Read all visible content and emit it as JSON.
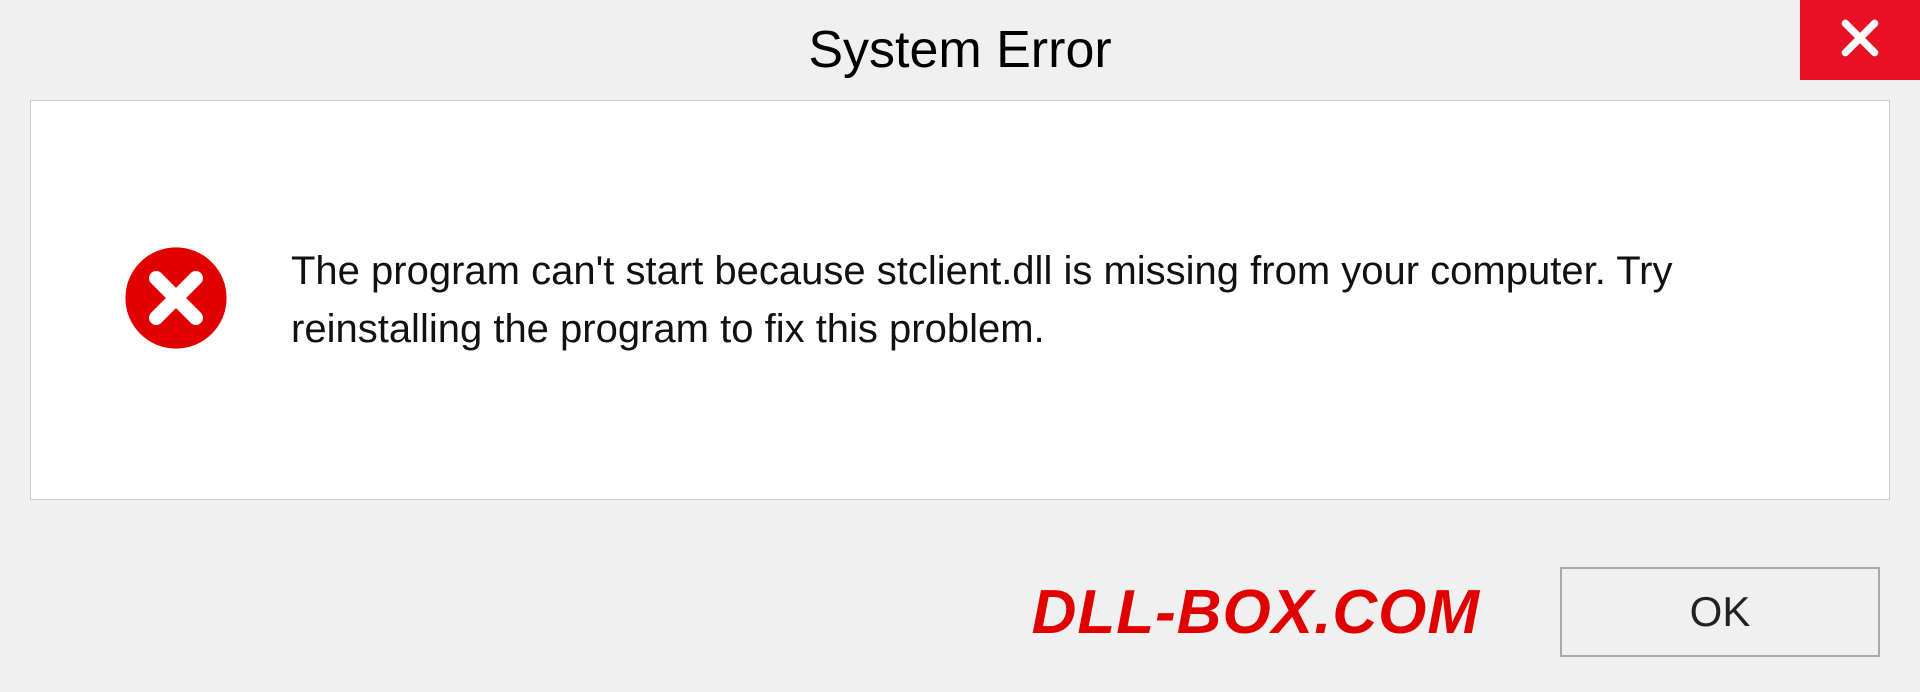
{
  "title": "System Error",
  "message": "The program can't start because stclient.dll is missing from your computer. Try reinstalling the program to fix this problem.",
  "brand": "DLL-BOX.COM",
  "ok_label": "OK",
  "colors": {
    "close_bg": "#e81123",
    "error_red": "#e00000",
    "brand_red": "#e00000"
  }
}
